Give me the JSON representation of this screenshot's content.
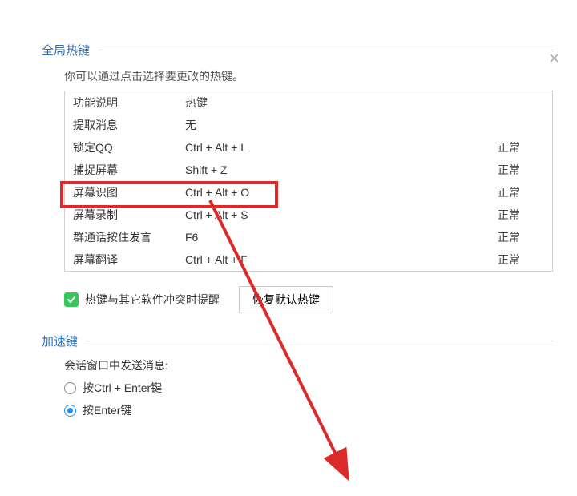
{
  "sections": {
    "global_hotkeys": {
      "title": "全局热键",
      "hint": "你可以通过点击选择要更改的热键。",
      "columns": {
        "desc": "功能说明",
        "hotkey": "热键"
      },
      "rows": [
        {
          "desc": "提取消息",
          "hotkey": "无",
          "status": ""
        },
        {
          "desc": "锁定QQ",
          "hotkey": "Ctrl + Alt + L",
          "status": "正常"
        },
        {
          "desc": "捕捉屏幕",
          "hotkey": "Shift + Z",
          "status": "正常"
        },
        {
          "desc": "屏幕识图",
          "hotkey": "Ctrl + Alt + O",
          "status": "正常"
        },
        {
          "desc": "屏幕录制",
          "hotkey": "Ctrl + Alt + S",
          "status": "正常"
        },
        {
          "desc": "群通话按住发言",
          "hotkey": "F6",
          "status": "正常"
        },
        {
          "desc": "屏幕翻译",
          "hotkey": "Ctrl + Alt + F",
          "status": "正常"
        }
      ],
      "conflict_checkbox": "热键与其它软件冲突时提醒",
      "restore_button": "恢复默认热键"
    },
    "accelerators": {
      "title": "加速键",
      "send_label": "会话窗口中发送消息:",
      "options": {
        "ctrl_enter": "按Ctrl + Enter键",
        "enter": "按Enter键"
      }
    }
  }
}
